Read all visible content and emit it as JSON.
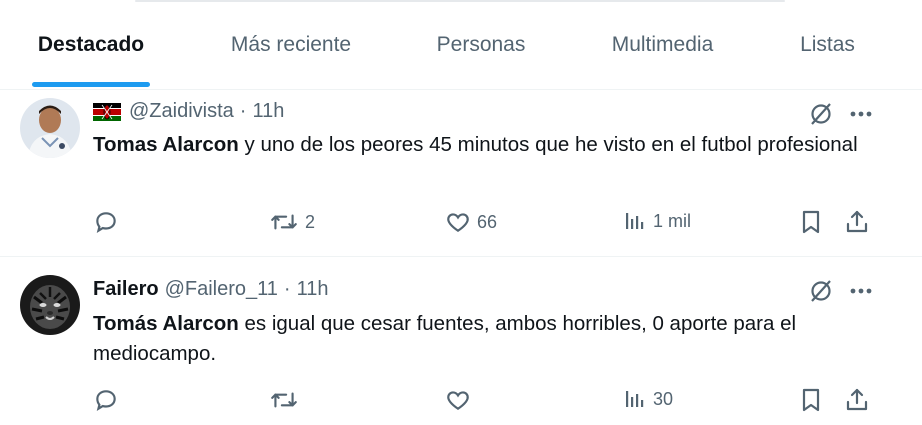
{
  "tabs": [
    {
      "label": "Destacado",
      "active": true
    },
    {
      "label": "Más reciente",
      "active": false
    },
    {
      "label": "Personas",
      "active": false
    },
    {
      "label": "Multimedia",
      "active": false
    },
    {
      "label": "Listas",
      "active": false
    }
  ],
  "tweets": [
    {
      "display_name": "",
      "handle": "@Zaidivista",
      "dot": "·",
      "time": "11h",
      "has_flag": true,
      "bold_text": "Tomas Alarcon",
      "text": " y uno de los peores 45 minutos que he visto en el futbol profesional",
      "replies": "",
      "reposts": "2",
      "likes": "66",
      "views": "1 mil"
    },
    {
      "display_name": "Failero",
      "handle": "@Failero_11",
      "dot": "·",
      "time": "11h",
      "has_flag": false,
      "bold_text": "Tomás Alarcon",
      "text": " es igual que cesar fuentes, ambos horribles, 0 aporte para el mediocampo.",
      "replies": "",
      "reposts": "",
      "likes": "",
      "views": "30"
    }
  ],
  "colors": {
    "accent": "#1d9bf0",
    "secondary_text": "#536471",
    "primary_text": "#0f1419"
  }
}
